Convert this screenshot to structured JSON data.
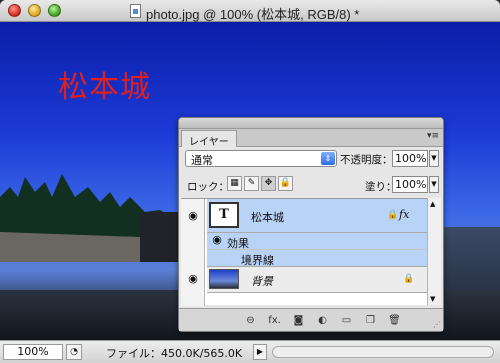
{
  "window": {
    "title": "photo.jpg @ 100% (松本城, RGB/8) *"
  },
  "canvas": {
    "overlay_text": "松本城",
    "overlay_color": "#e02020"
  },
  "layers_panel": {
    "tab_label": "レイヤー",
    "menu_icon": "▾≡",
    "blend_mode": "通常",
    "opacity_label": "不透明度：",
    "opacity_value": "100%",
    "lock_label": "ロック：",
    "fill_label": "塗り：",
    "fill_value": "100%",
    "layers": [
      {
        "name": "松本城",
        "thumb_text": "T",
        "fx": "fx",
        "effects_label": "効果",
        "effect_items": [
          "境界線"
        ]
      },
      {
        "name": "背景"
      }
    ],
    "footer_icons": [
      "link-icon",
      "fx-icon",
      "mask-icon",
      "adjustment-icon",
      "group-icon",
      "new-layer-icon",
      "trash-icon"
    ],
    "footer_fx_label": "fx."
  },
  "statusbar": {
    "zoom": "100%",
    "file_info": "ファイル：450.0K/565.0K"
  }
}
